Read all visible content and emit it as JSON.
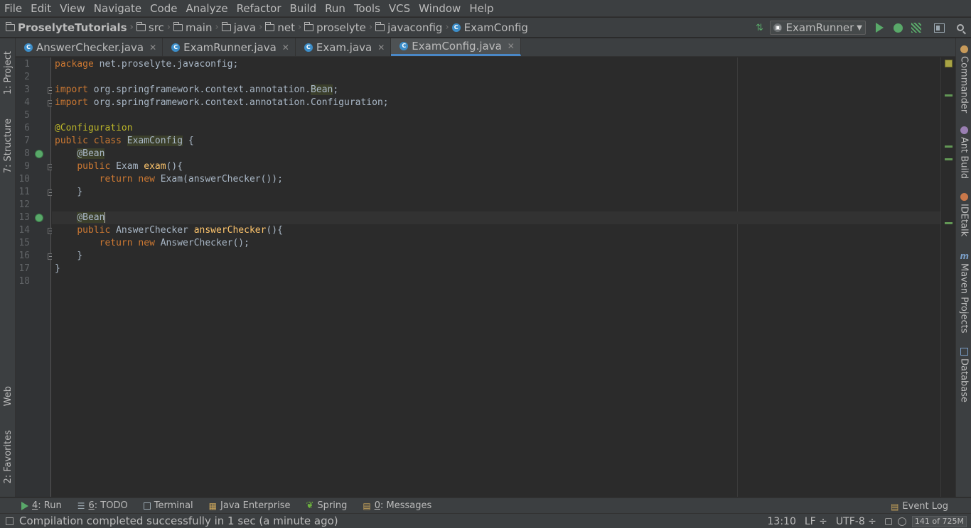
{
  "menu": [
    "File",
    "Edit",
    "View",
    "Navigate",
    "Code",
    "Analyze",
    "Refactor",
    "Build",
    "Run",
    "Tools",
    "VCS",
    "Window",
    "Help"
  ],
  "breadcrumbs": {
    "project": "ProselyteTutorials",
    "folders": [
      "src",
      "main",
      "java",
      "net",
      "proselyte",
      "javaconfig"
    ],
    "file": "ExamConfig"
  },
  "toolbar": {
    "run_config": "ExamRunner"
  },
  "left_tools": [
    "1: Project",
    "7: Structure",
    "Web",
    "2: Favorites"
  ],
  "right_tools": [
    "Commander",
    "Ant Build",
    "IDEtalk",
    "Maven Projects",
    "Database"
  ],
  "tabs": [
    {
      "label": "AnswerChecker.java"
    },
    {
      "label": "ExamRunner.java"
    },
    {
      "label": "Exam.java"
    },
    {
      "label": "ExamConfig.java"
    }
  ],
  "code": {
    "line_numbers": [
      "1",
      "2",
      "3",
      "4",
      "5",
      "6",
      "7",
      "8",
      "9",
      "10",
      "11",
      "12",
      "13",
      "14",
      "15",
      "16",
      "17",
      "18"
    ],
    "l1_kw": "package",
    "l1_rest": " net.proselyte.javaconfig;",
    "l3_kw": "import",
    "l3_rest": " org.springframework.context.annotation.",
    "l3_ann": "Bean",
    "l3_end": ";",
    "l4_kw": "import",
    "l4_rest": " org.springframework.context.annotation.Configuration;",
    "l6_ann": "@Configuration",
    "l7_kw": "public class",
    "l7_cls": "ExamConfig",
    "l7_end": " {",
    "l8_ann": "@Bean",
    "l9_kw": "public",
    "l9_type": " Exam ",
    "l9_fn": "exam",
    "l9_end": "(){",
    "l10_kw1": "return new",
    "l10_rest": " Exam(answerChecker());",
    "l11": "}",
    "l13_ann": "@Bean",
    "l14_kw": "public",
    "l14_type": " AnswerChecker ",
    "l14_fn": "answerChecker",
    "l14_end": "(){",
    "l15_kw": "return new",
    "l15_rest": " AnswerChecker();",
    "l16": "}",
    "l17": "}"
  },
  "bottom_tools": {
    "run_num": "4",
    "run_label": ": Run",
    "todo_num": "6",
    "todo_label": ": TODO",
    "terminal": "Terminal",
    "java_ee": "Java Enterprise",
    "spring": "Spring",
    "messages_num": "0",
    "messages_label": ": Messages",
    "event_log": "Event Log"
  },
  "status": {
    "message": "Compilation completed successfully in 1 sec (a minute ago)",
    "position": "13:10",
    "line_sep": "LF ÷",
    "encoding": "UTF-8 ÷",
    "memory": "141 of 725M"
  },
  "colors": {
    "keyword": "#cc7832",
    "annotation": "#bbb529",
    "method": "#ffc66d",
    "accent": "#4a88c7",
    "run_green": "#59a869"
  }
}
